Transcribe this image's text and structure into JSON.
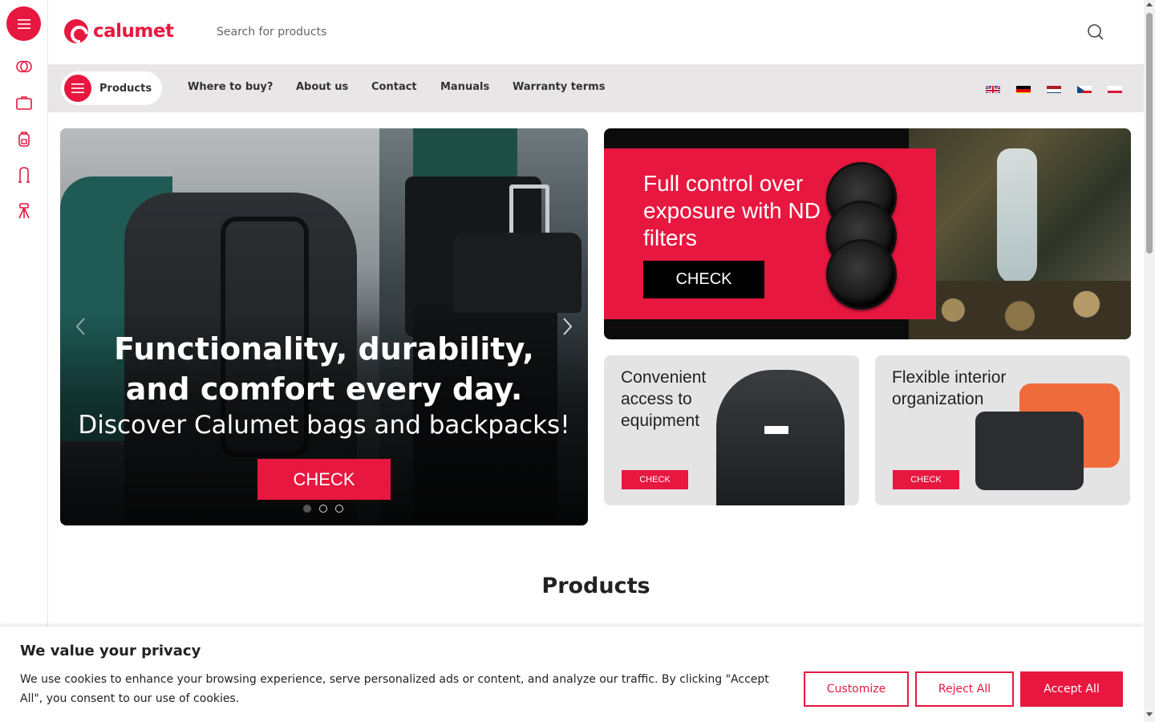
{
  "brand": {
    "name": "calumet",
    "color": "#e8173f"
  },
  "search": {
    "placeholder": "Search for products",
    "icon": "search-icon"
  },
  "rail": {
    "items": [
      {
        "name": "filters-category",
        "icon": "rings-icon"
      },
      {
        "name": "bags-category",
        "icon": "briefcase-icon"
      },
      {
        "name": "backpacks-category",
        "icon": "backpack-icon"
      },
      {
        "name": "backdrops-category",
        "icon": "stand-icon"
      },
      {
        "name": "tripods-category",
        "icon": "tripod-icon"
      }
    ]
  },
  "nav": {
    "products_label": "Products",
    "links": [
      "Where to buy?",
      "About us",
      "Contact",
      "Manuals",
      "Warranty terms"
    ],
    "languages": [
      "English",
      "Deutsch",
      "Nederlands",
      "Čeština",
      "Polski"
    ]
  },
  "hero": {
    "title_line1": "Functionality, durability,",
    "title_line2": "and comfort every day.",
    "subtitle": "Discover Calumet bags and backpacks!",
    "cta": "CHECK",
    "slides": 3,
    "active_slide": 1
  },
  "nd_banner": {
    "text": "Full control over exposure with ND filters",
    "cta": "CHECK"
  },
  "tiles": [
    {
      "text": "Convenient access to equipment",
      "cta": "CHECK"
    },
    {
      "text": "Flexible interior organization",
      "cta": "CHECK"
    }
  ],
  "section": {
    "products_heading": "Products"
  },
  "cookie": {
    "title": "We value your privacy",
    "text": "We use cookies to enhance your browsing experience, serve personalized ads or content, and analyze our traffic. By clicking \"Accept All\", you consent to our use of cookies.",
    "customize": "Customize",
    "reject": "Reject All",
    "accept": "Accept All"
  }
}
